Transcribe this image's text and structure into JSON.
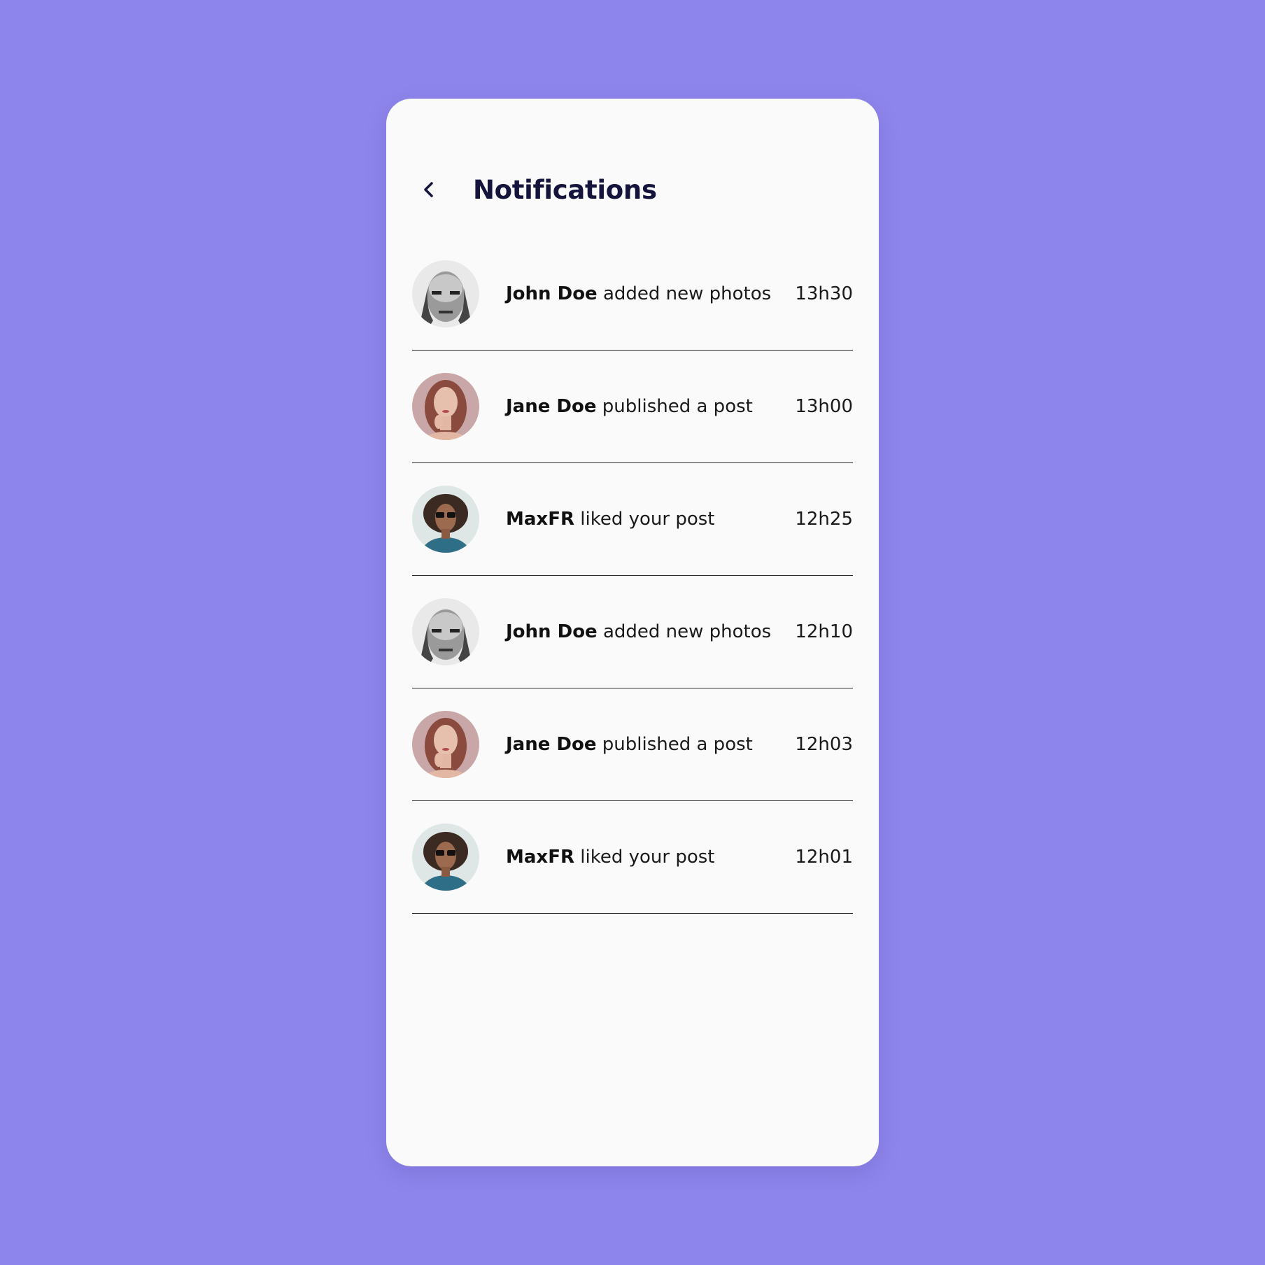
{
  "colors": {
    "background": "#8e85ec",
    "card": "#fafafa",
    "title": "#14143c",
    "divider": "#2c2c2c"
  },
  "header": {
    "title": "Notifications",
    "back_icon": "chevron-left-icon"
  },
  "notifications": [
    {
      "name": "John Doe",
      "action": " added new photos",
      "time": "13h30",
      "avatar": "john"
    },
    {
      "name": "Jane Doe",
      "action": " published a post",
      "time": "13h00",
      "avatar": "jane"
    },
    {
      "name": "MaxFR",
      "action": " liked your post",
      "time": "12h25",
      "avatar": "max"
    },
    {
      "name": "John Doe",
      "action": " added new photos",
      "time": "12h10",
      "avatar": "john"
    },
    {
      "name": "Jane Doe",
      "action": " published a post",
      "time": "12h03",
      "avatar": "jane"
    },
    {
      "name": "MaxFR",
      "action": " liked your post",
      "time": "12h01",
      "avatar": "max"
    }
  ]
}
